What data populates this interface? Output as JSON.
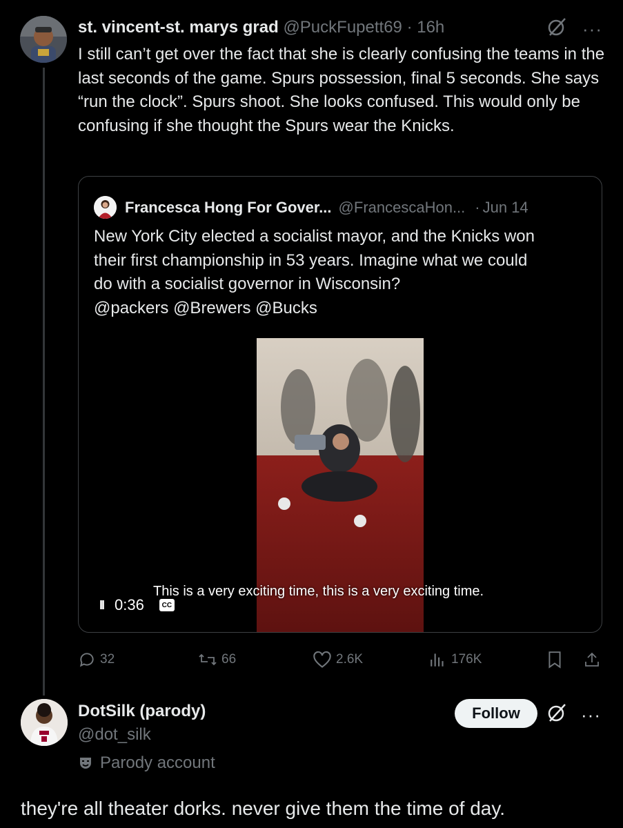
{
  "tweet1": {
    "display_name": "st. vincent-st. marys grad",
    "handle": "@PuckFupett69",
    "separator": "·",
    "time": "16h",
    "more_label": "···",
    "text": "I still can’t get over the fact that she is clearly confusing the teams in the last seconds of the game. Spurs possession, final 5 seconds. She says “run the clock”. Spurs shoot. She looks confused. This would only be confusing if she thought the Spurs wear the Knicks.",
    "quote": {
      "display_name": "Francesca Hong For Gover...",
      "handle": "@FrancescaHon...",
      "separator": "·",
      "date": "Jun 14",
      "text_lines": [
        "New York City elected a socialist mayor, and the Knicks won",
        "their first championship in 53 years. Imagine what we could",
        "do with a socialist governor in Wisconsin?",
        "@packers @Brewers @Bucks"
      ],
      "video": {
        "caption": "This is a very exciting time, this is a very exciting time.",
        "time": "0:36",
        "pause_icon": "II",
        "cc_label": "CC"
      }
    },
    "actions": {
      "replies": "32",
      "reposts": "66",
      "likes": "2.6K",
      "views": "176K"
    }
  },
  "tweet2": {
    "display_name": "DotSilk (parody)",
    "handle": "@dot_silk",
    "parody_label": "Parody account",
    "follow_label": "Follow",
    "more_label": "···",
    "text": "they're all theater dorks. never give them the time of day."
  },
  "colors": {
    "background": "#000000",
    "text": "#e7e9ea",
    "muted": "#71767b",
    "border": "#3e4144",
    "follow_bg": "#eff3f4"
  }
}
